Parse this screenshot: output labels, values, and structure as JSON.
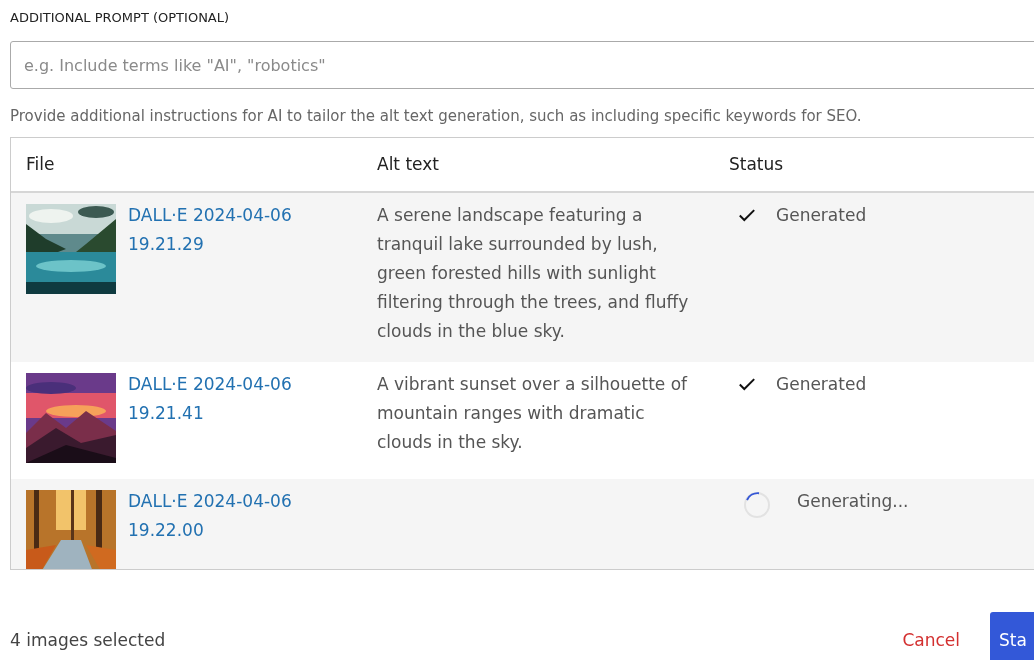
{
  "prompt": {
    "label": "ADDITIONAL PROMPT (OPTIONAL)",
    "placeholder": "e.g. Include terms like \"AI\", \"robotics\"",
    "help": "Provide additional instructions for AI to tailor the alt text generation, such as including specific keywords for SEO."
  },
  "table": {
    "columns": [
      "File",
      "Alt text",
      "Status"
    ],
    "rows": [
      {
        "file": "DALL·E 2024-04-06 19.21.29",
        "alt_text": "A serene landscape featuring a tranquil lake surrounded by lush, green forested hills with sunlight filtering through the trees, and fluffy clouds in the blue sky.",
        "status": {
          "kind": "generated",
          "label": "Generated"
        }
      },
      {
        "file": "DALL·E 2024-04-06 19.21.41",
        "alt_text": "A vibrant sunset over a silhouette of mountain ranges with dramatic clouds in the sky.",
        "status": {
          "kind": "generated",
          "label": "Generated"
        }
      },
      {
        "file": "DALL·E 2024-04-06 19.22.00",
        "status": {
          "kind": "generating",
          "label": "Generating..."
        }
      }
    ]
  },
  "footer": {
    "count": "4 images selected",
    "cancel": "Cancel",
    "start": "Sta"
  }
}
